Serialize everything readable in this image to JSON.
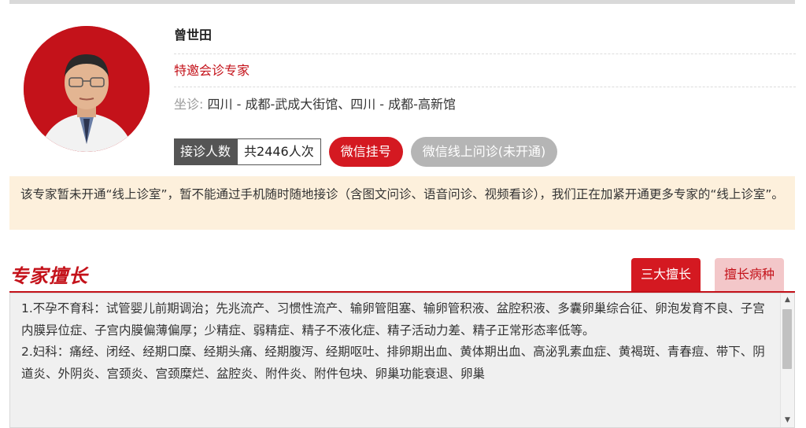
{
  "doctor": {
    "name": "曾世田",
    "title": "特邀会诊专家",
    "location_label": "坐诊:",
    "location_value": "四川 - 成都-武成大街馆、四川 - 成都-高新馆"
  },
  "stats": {
    "visits_label": "接诊人数",
    "visits_value": "共2446人次"
  },
  "buttons": {
    "wechat_register": "微信挂号",
    "wechat_online": "微信线上问诊(未开通)"
  },
  "notice": {
    "text": "该专家暂未开通“线上诊室”，暂不能通过手机随时随地接诊（含图文问诊、语音问诊、视频看诊），我们正在加紧开通更多专家的“线上诊室”。"
  },
  "specialty": {
    "heading": "专家擅长",
    "tabs": [
      "三大擅长",
      "擅长病种"
    ],
    "active_tab": "三大擅长",
    "items": [
      "1.不孕不育科：试管婴儿前期调治；先兆流产、习惯性流产、输卵管阻塞、输卵管积液、盆腔积液、多囊卵巢综合征、卵泡发育不良、子宫内膜异位症、子宫内膜偏薄偏厚；少精症、弱精症、精子不液化症、精子活动力差、精子正常形态率低等。",
      "2.妇科：痛经、闭经、经期口糜、经期头痛、经期腹泻、经期呕吐、排卵期出血、黄体期出血、高泌乳素血症、黄褐斑、青春痘、带下、阴道炎、外阴炎、宫颈炎、宫颈糜烂、盆腔炎、附件炎、附件包块、卵巢功能衰退、卵巢"
    ]
  },
  "colors": {
    "accent": "#c4121a",
    "button_red": "#d41921",
    "button_gray": "#b5b5b5",
    "notice_bg": "#fdf0dc"
  },
  "icons": [
    "scroll-up-arrow-icon",
    "scroll-down-arrow-icon"
  ]
}
